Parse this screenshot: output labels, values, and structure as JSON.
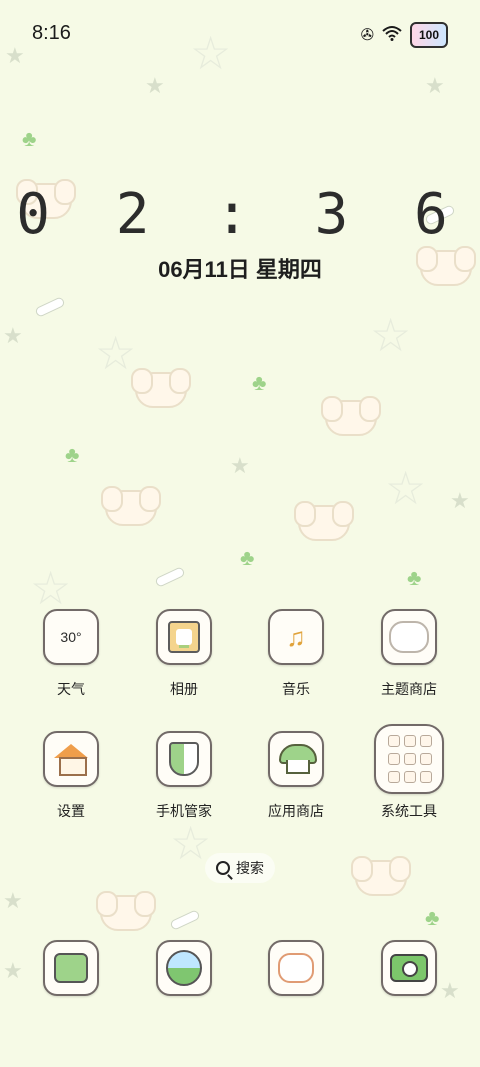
{
  "status_bar": {
    "time": "8:16",
    "icons": [
      "nfc-icon",
      "wifi-icon"
    ],
    "battery": "100"
  },
  "clock": {
    "time": "0 2 : 3 6",
    "date": "06月11日 星期四"
  },
  "apps": [
    {
      "label": "天气",
      "icon": "weather-icon",
      "icon_text": "30°"
    },
    {
      "label": "相册",
      "icon": "gallery-icon"
    },
    {
      "label": "音乐",
      "icon": "music-icon"
    },
    {
      "label": "主题商店",
      "icon": "theme-store-icon"
    },
    {
      "label": "设置",
      "icon": "settings-house-icon"
    },
    {
      "label": "手机管家",
      "icon": "phone-manager-shield-icon"
    },
    {
      "label": "应用商店",
      "icon": "app-store-icon"
    },
    {
      "label": "系统工具",
      "icon": "system-tools-folder-icon"
    }
  ],
  "search": {
    "label": "搜索"
  },
  "dock": [
    {
      "icon": "tv-character-icon"
    },
    {
      "icon": "globe-browser-icon"
    },
    {
      "icon": "cat-face-icon"
    },
    {
      "icon": "camera-icon"
    }
  ],
  "colors": {
    "background": "#f6fae6",
    "accent_green": "#9ed38a",
    "icon_border": "#726a68"
  }
}
